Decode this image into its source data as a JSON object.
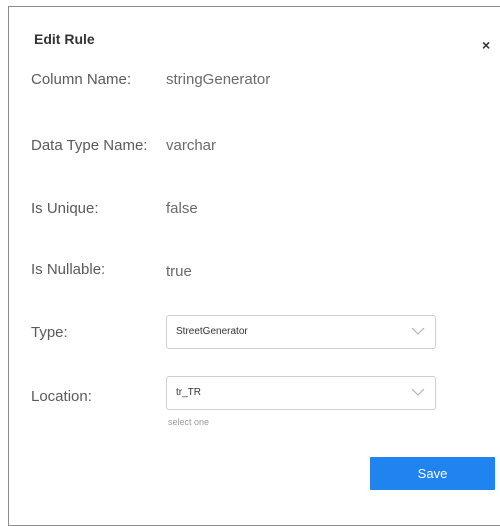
{
  "dialog": {
    "title": "Edit Rule",
    "close_label": "×"
  },
  "fields": {
    "column_name": {
      "label": "Column Name:",
      "value": "stringGenerator"
    },
    "data_type_name": {
      "label": "Data Type Name:",
      "value": "varchar"
    },
    "is_unique": {
      "label": "Is Unique:",
      "value": "false"
    },
    "is_nullable": {
      "label": "Is Nullable:",
      "value": "true"
    },
    "type": {
      "label": "Type:",
      "selected": "StreetGenerator",
      "icon": "chevron-down-icon"
    },
    "location": {
      "label": "Location:",
      "selected": "tr_TR",
      "hint": "select one",
      "icon": "chevron-down-icon"
    }
  },
  "actions": {
    "save_label": "Save"
  },
  "colors": {
    "primary": "#1f84f0",
    "border": "#8c8c8c"
  }
}
